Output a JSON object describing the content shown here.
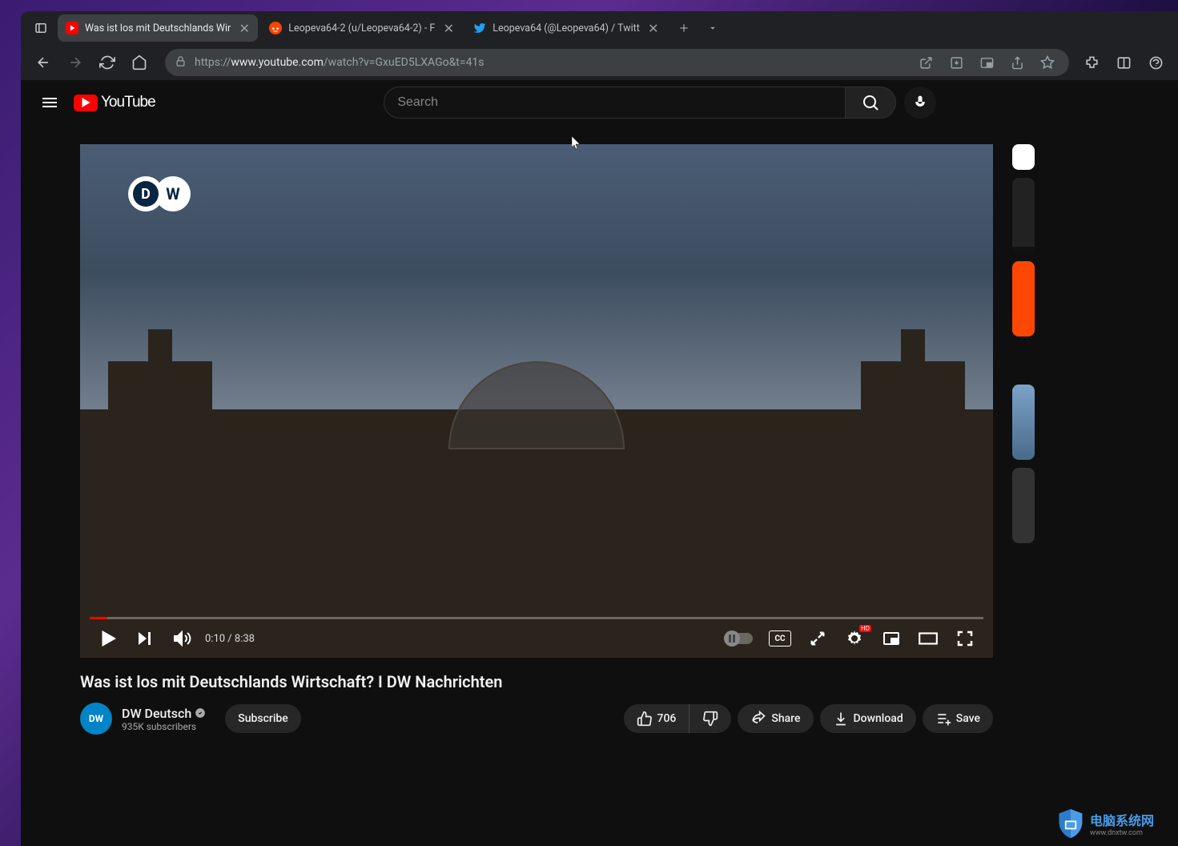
{
  "browser": {
    "tabs": [
      {
        "title": "Was ist los mit Deutschlands Wir",
        "favicon": "youtube"
      },
      {
        "title": "Leopeva64-2 (u/Leopeva64-2) - F",
        "favicon": "reddit"
      },
      {
        "title": "Leopeva64 (@Leopeva64) / Twitt",
        "favicon": "twitter"
      }
    ],
    "url": {
      "protocol": "https://",
      "host": "www.youtube.com",
      "path": "/watch?v=GxuED5LXAGo&t=41s"
    }
  },
  "youtube": {
    "logo_text": "YouTube",
    "search_placeholder": "Search"
  },
  "player": {
    "dw_logo": "DW",
    "time_current": "0:10",
    "time_duration": "8:38",
    "cc_label": "CC",
    "hd_label": "HD"
  },
  "video": {
    "title": "Was ist los mit Deutschlands Wirtschaft? I DW Nachrichten",
    "channel": {
      "name": "DW Deutsch",
      "avatar_text": "DW",
      "subscribers": "935K subscribers"
    },
    "subscribe_label": "Subscribe",
    "likes": "706",
    "share_label": "Share",
    "download_label": "Download",
    "save_label": "Save"
  },
  "watermark": {
    "text": "电脑系统网",
    "url": "www.dnxtw.com"
  }
}
